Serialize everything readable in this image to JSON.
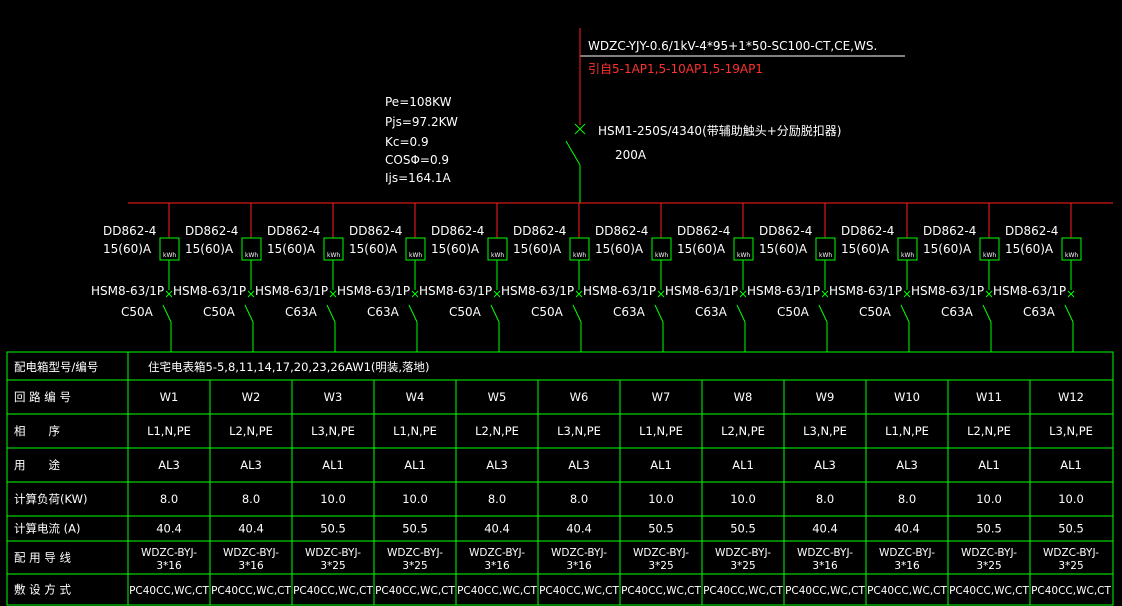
{
  "incoming": {
    "cable": "WDZC-YJY-0.6/1kV-4*95+1*50-SC100-CT,CE,WS.",
    "source": "引自5-1AP1,5-10AP1,5-19AP1"
  },
  "main_switch": {
    "model": "HSM1-250S/4340(带辅助触头+分励脱扣器)",
    "rating": "200A"
  },
  "load_summary": {
    "pe": "Pe=108KW",
    "pjs": "Pjs=97.2KW",
    "kc": "Kc=0.9",
    "cos": "COSΦ=0.9",
    "ijs": "Ijs=164.1A"
  },
  "meter_icon_label": "kWh",
  "circuits": [
    {
      "meter": "DD862-4",
      "meter_rating": "15(60)A",
      "breaker": "HSM8-63/1P",
      "breaker_rating": "C50A"
    },
    {
      "meter": "DD862-4",
      "meter_rating": "15(60)A",
      "breaker": "HSM8-63/1P",
      "breaker_rating": "C50A"
    },
    {
      "meter": "DD862-4",
      "meter_rating": "15(60)A",
      "breaker": "HSM8-63/1P",
      "breaker_rating": "C63A"
    },
    {
      "meter": "DD862-4",
      "meter_rating": "15(60)A",
      "breaker": "HSM8-63/1P",
      "breaker_rating": "C63A"
    },
    {
      "meter": "DD862-4",
      "meter_rating": "15(60)A",
      "breaker": "HSM8-63/1P",
      "breaker_rating": "C50A"
    },
    {
      "meter": "DD862-4",
      "meter_rating": "15(60)A",
      "breaker": "HSM8-63/1P",
      "breaker_rating": "C50A"
    },
    {
      "meter": "DD862-4",
      "meter_rating": "15(60)A",
      "breaker": "HSM8-63/1P",
      "breaker_rating": "C63A"
    },
    {
      "meter": "DD862-4",
      "meter_rating": "15(60)A",
      "breaker": "HSM8-63/1P",
      "breaker_rating": "C63A"
    },
    {
      "meter": "DD862-4",
      "meter_rating": "15(60)A",
      "breaker": "HSM8-63/1P",
      "breaker_rating": "C50A"
    },
    {
      "meter": "DD862-4",
      "meter_rating": "15(60)A",
      "breaker": "HSM8-63/1P",
      "breaker_rating": "C50A"
    },
    {
      "meter": "DD862-4",
      "meter_rating": "15(60)A",
      "breaker": "HSM8-63/1P",
      "breaker_rating": "C63A"
    },
    {
      "meter": "DD862-4",
      "meter_rating": "15(60)A",
      "breaker": "HSM8-63/1P",
      "breaker_rating": "C63A"
    }
  ],
  "table": {
    "box_label": "配电箱型号/编号",
    "box_value": "住宅电表箱5-5,8,11,14,17,20,23,26AW1(明装,落地)",
    "row_labels": [
      "回 路 编 号",
      "相　　序",
      "用　　途",
      "计算负荷(KW)",
      "计算电流 (A)",
      "配 用 导 线",
      "敷 设 方 式"
    ],
    "circuit_ids": [
      "W1",
      "W2",
      "W3",
      "W4",
      "W5",
      "W6",
      "W7",
      "W8",
      "W9",
      "W10",
      "W11",
      "W12"
    ],
    "phases": [
      "L1,N,PE",
      "L2,N,PE",
      "L3,N,PE",
      "L1,N,PE",
      "L2,N,PE",
      "L3,N,PE",
      "L1,N,PE",
      "L2,N,PE",
      "L3,N,PE",
      "L1,N,PE",
      "L2,N,PE",
      "L3,N,PE"
    ],
    "uses": [
      "AL3",
      "AL3",
      "AL1",
      "AL1",
      "AL3",
      "AL3",
      "AL1",
      "AL1",
      "AL3",
      "AL3",
      "AL1",
      "AL1"
    ],
    "loads": [
      "8.0",
      "8.0",
      "10.0",
      "10.0",
      "8.0",
      "8.0",
      "10.0",
      "10.0",
      "8.0",
      "8.0",
      "10.0",
      "10.0"
    ],
    "currents": [
      "40.4",
      "40.4",
      "50.5",
      "50.5",
      "40.4",
      "40.4",
      "50.5",
      "50.5",
      "40.4",
      "40.4",
      "50.5",
      "50.5"
    ],
    "cable_types": [
      "WDZC-BYJ-",
      "WDZC-BYJ-",
      "WDZC-BYJ-",
      "WDZC-BYJ-",
      "WDZC-BYJ-",
      "WDZC-BYJ-",
      "WDZC-BYJ-",
      "WDZC-BYJ-",
      "WDZC-BYJ-",
      "WDZC-BYJ-",
      "WDZC-BYJ-",
      "WDZC-BYJ-"
    ],
    "cable_sizes": [
      "3*16",
      "3*16",
      "3*25",
      "3*25",
      "3*16",
      "3*16",
      "3*25",
      "3*25",
      "3*16",
      "3*16",
      "3*25",
      "3*25"
    ],
    "methods": [
      "PC40CC,WC,CT",
      "PC40CC,WC,CT",
      "PC40CC,WC,CT",
      "PC40CC,WC,CT",
      "PC40CC,WC,CT",
      "PC40CC,WC,CT",
      "PC40CC,WC,CT",
      "PC40CC,WC,CT",
      "PC40CC,WC,CT",
      "PC40CC,WC,CT",
      "PC40CC,WC,CT",
      "PC40CC,WC,CT"
    ]
  },
  "colors": {
    "background": "#000000",
    "busbar": "#ff2020",
    "wire": "#00ff00",
    "text": "#ffffff",
    "source_text": "#ff3030",
    "meter_box": "#00ff00"
  }
}
